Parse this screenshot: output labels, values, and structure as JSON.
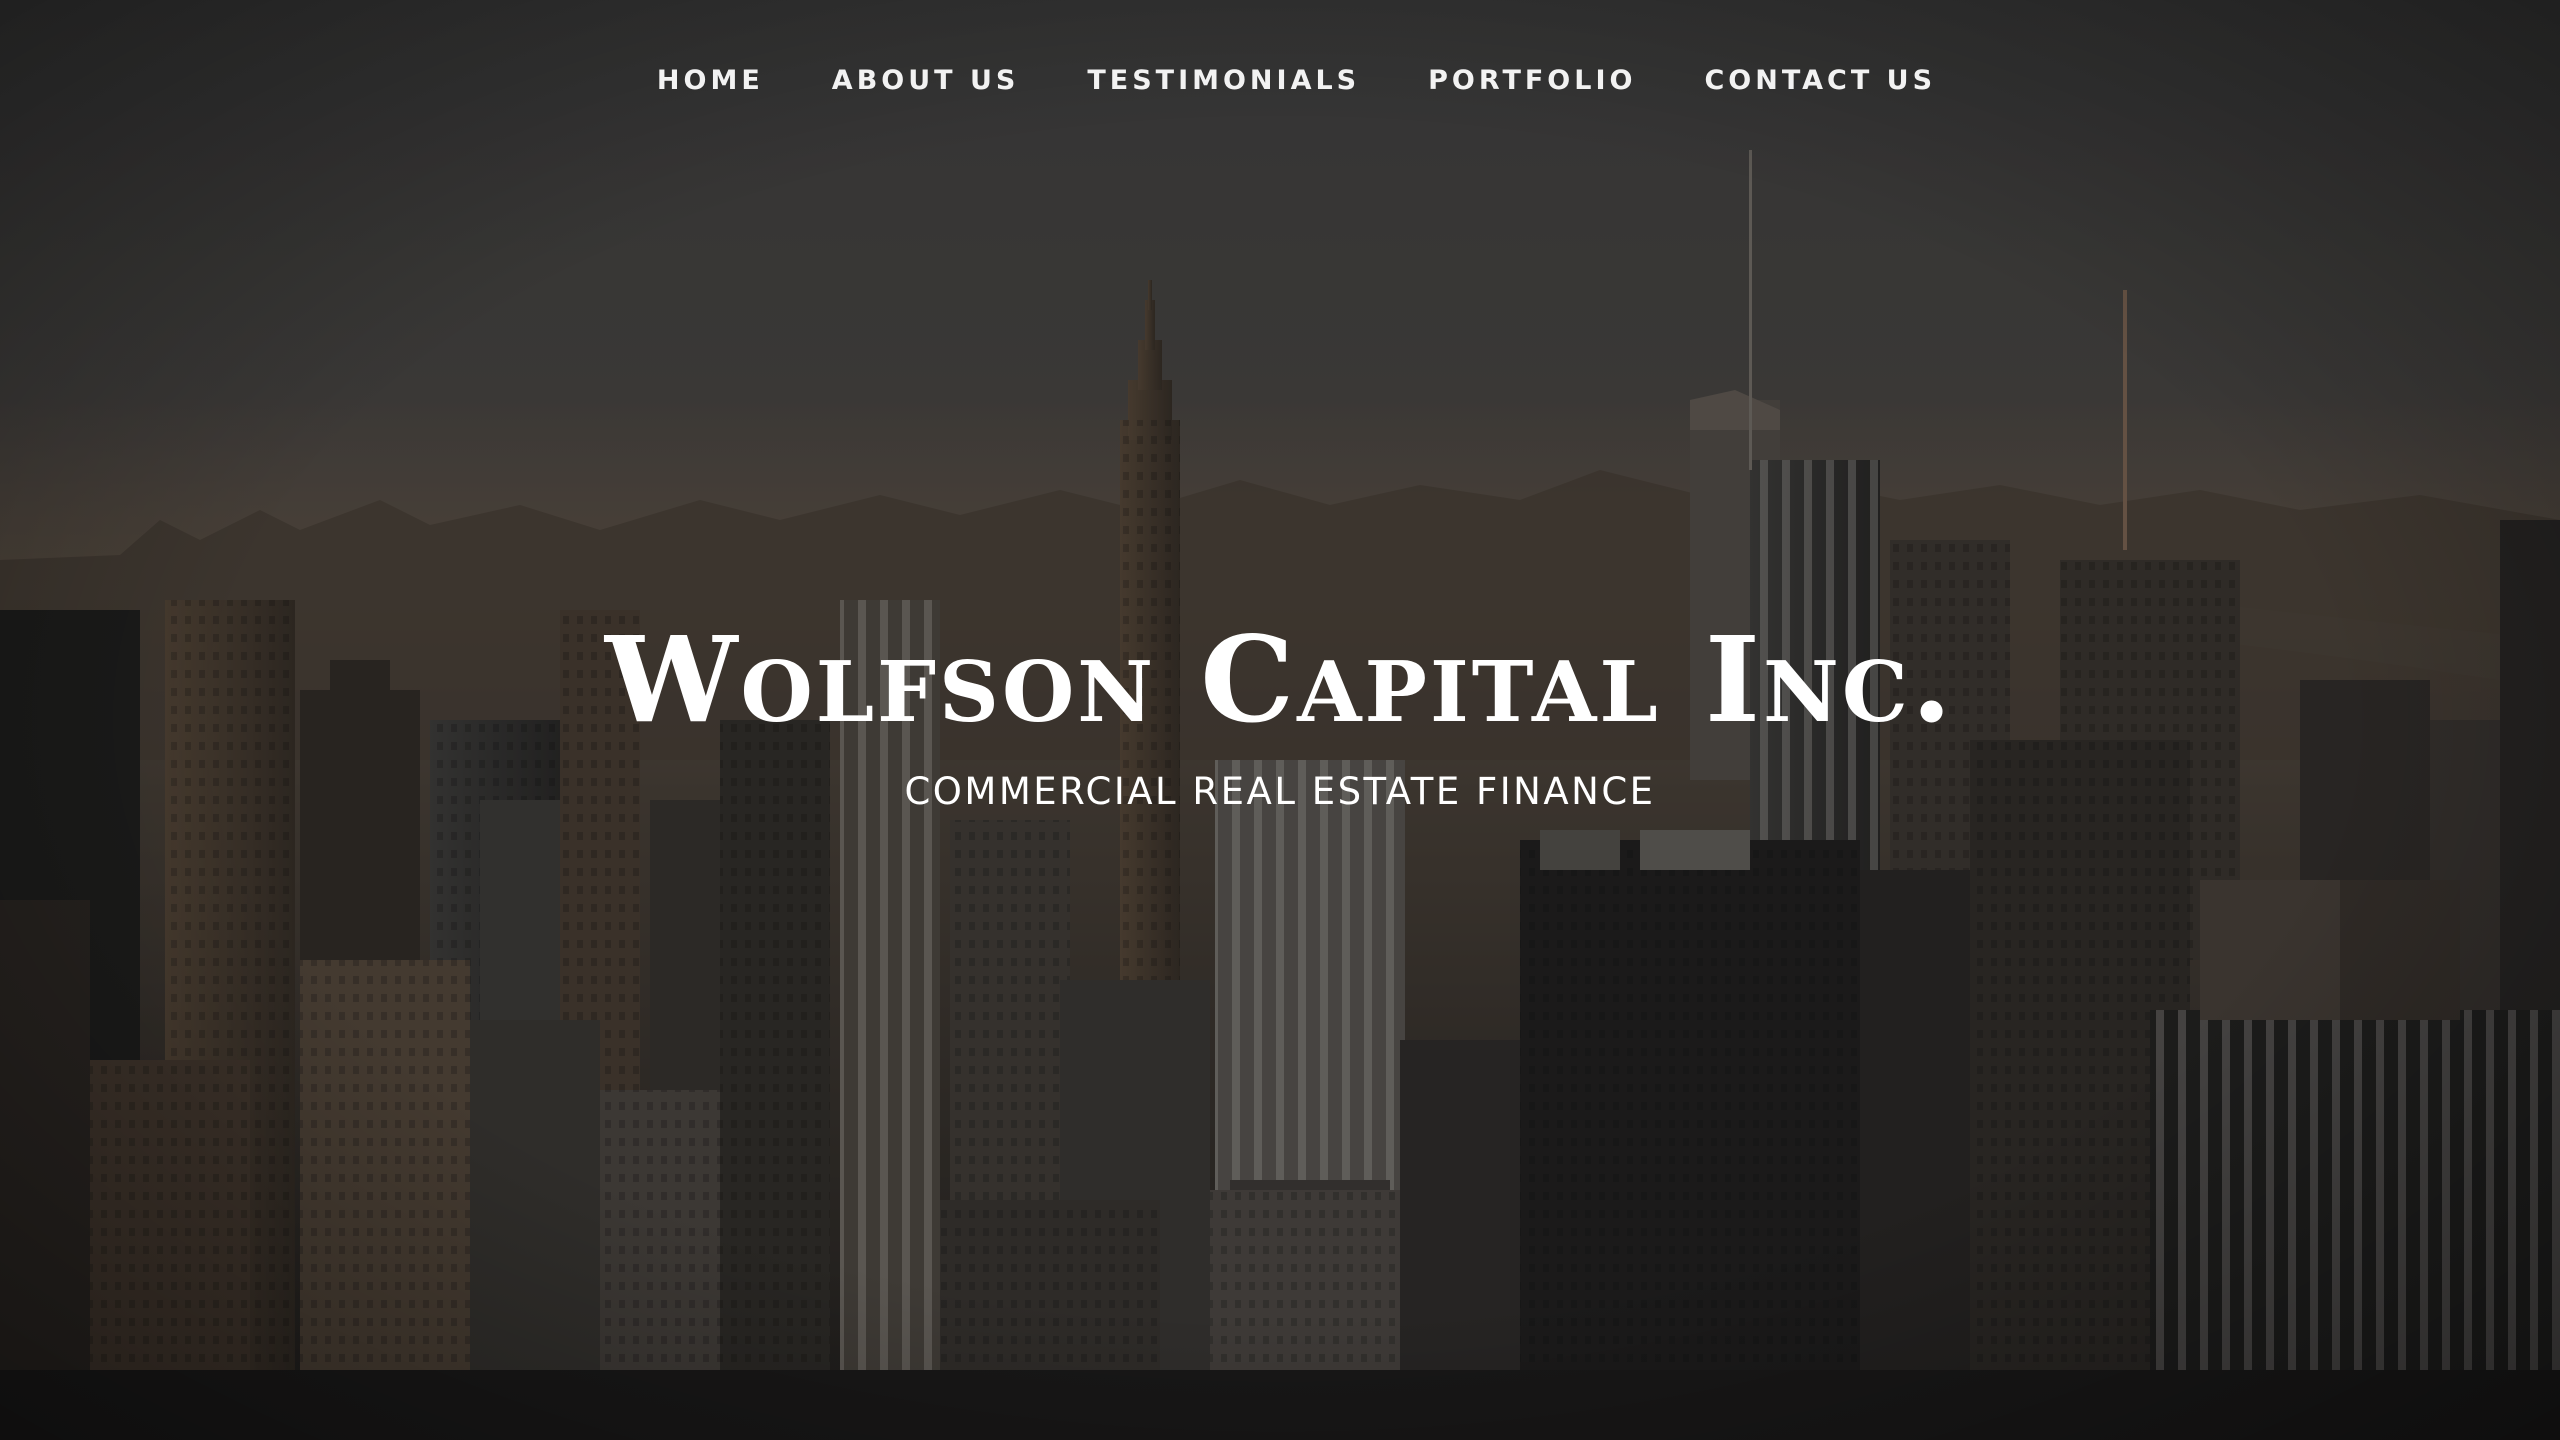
{
  "nav": {
    "items": [
      {
        "label": "HOME"
      },
      {
        "label": "ABOUT US"
      },
      {
        "label": "TESTIMONIALS"
      },
      {
        "label": "PORTFOLIO"
      },
      {
        "label": "CONTACT US"
      }
    ]
  },
  "hero": {
    "title": "Wolfson Capital Inc.",
    "subtitle": "COMMERCIAL REAL ESTATE FINANCE",
    "background": "city-skyline-image"
  },
  "colors": {
    "overlay": "#1e1e1e",
    "text": "#ffffff",
    "sky": "#4a4744",
    "haze": "#6e5a45",
    "building_dark": "#181716",
    "building_mid": "#3b342c",
    "building_warm": "#5c4a38"
  }
}
